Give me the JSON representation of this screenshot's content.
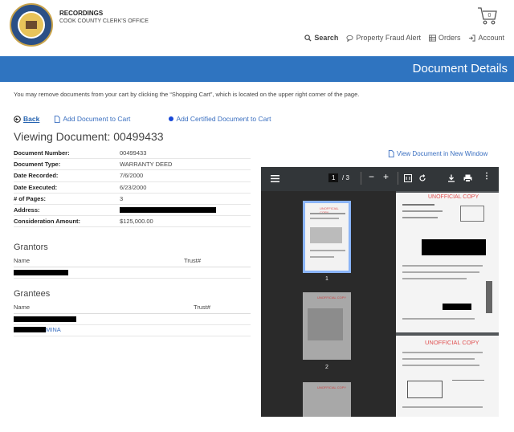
{
  "header": {
    "brand_title": "RECORDINGS",
    "brand_subtitle": "COOK COUNTY CLERK'S OFFICE",
    "cart_count": "0",
    "nav": [
      {
        "label": "Search",
        "icon": "search-icon"
      },
      {
        "label": "Property Fraud Alert",
        "icon": "chat-icon"
      },
      {
        "label": "Orders",
        "icon": "grid-icon"
      },
      {
        "label": "Account",
        "icon": "sign-in-icon"
      }
    ]
  },
  "banner": {
    "title": "Document Details"
  },
  "notice": "You may remove documents from your cart by clicking the “Shopping Cart”, which is located on the upper right corner of the page.",
  "actions": {
    "back": "Back",
    "add_to_cart": "Add Document to Cart",
    "add_certified": "Add Certified Document to Cart"
  },
  "viewing_title": "Viewing Document: 00499433",
  "details": [
    {
      "label": "Document Number:",
      "value": "00499433"
    },
    {
      "label": "Document Type:",
      "value": "WARRANTY DEED"
    },
    {
      "label": "Date Recorded:",
      "value": "7/6/2000"
    },
    {
      "label": "Date Executed:",
      "value": "6/23/2000"
    },
    {
      "label": "# of Pages:",
      "value": "3"
    },
    {
      "label": "Address:",
      "value": ""
    },
    {
      "label": "Consideration Amount:",
      "value": "$125,000.00"
    }
  ],
  "grantors": {
    "title": "Grantors",
    "col_name": "Name",
    "col_trust": "Trust#"
  },
  "grantees": {
    "title": "Grantees",
    "col_name": "Name",
    "col_trust": "Trust#",
    "second_row_suffix": "MINA"
  },
  "view_new_window": "View Document in New Window",
  "pdf": {
    "current_page": "1",
    "total_pages": "/ 3",
    "thumb_labels": [
      "1",
      "2"
    ],
    "watermark": "UNOFFICIAL COPY"
  },
  "colors": {
    "banner": "#2f74c0",
    "link": "#3a6fc0",
    "viewer_bg": "#525659"
  }
}
